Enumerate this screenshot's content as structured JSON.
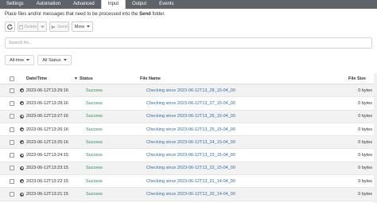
{
  "tabs": [
    {
      "label": "Settings"
    },
    {
      "label": "Automation"
    },
    {
      "label": "Advanced"
    },
    {
      "label": "Input"
    },
    {
      "label": "Output"
    },
    {
      "label": "Events"
    }
  ],
  "intro": {
    "prefix": "Place files and/or messages that need to be processed into the ",
    "folder": "Send",
    "suffix": " folder."
  },
  "toolbar": {
    "delete_label": "Delete",
    "send_label": "Send",
    "more_label": "More"
  },
  "search": {
    "placeholder": "Search for..."
  },
  "filters": {
    "time_label": "All-time",
    "status_label": "All Status"
  },
  "table": {
    "headers": {
      "date": "Date/Time",
      "status": "Status",
      "name": "File Name",
      "size": "File Size"
    },
    "rows": [
      {
        "date": "2023-06-12T13:29:16",
        "status": "Success",
        "name": "Checking since 2023-06-12T13_28_15-04_00",
        "size": "0 bytes"
      },
      {
        "date": "2023-06-12T13:28:16",
        "status": "Success",
        "name": "Checking since 2023-06-12T13_27_15-04_00",
        "size": "0 bytes"
      },
      {
        "date": "2023-06-12T13:27:16",
        "status": "Success",
        "name": "Checking since 2023-06-12T13_26_15-04_00",
        "size": "0 bytes"
      },
      {
        "date": "2023-06-12T13:26:16",
        "status": "Success",
        "name": "Checking since 2023-06-12T13_25_15-04_00",
        "size": "0 bytes"
      },
      {
        "date": "2023-06-12T13:25:16",
        "status": "Success",
        "name": "Checking since 2023-06-12T13_24_15-04_00",
        "size": "0 bytes"
      },
      {
        "date": "2023-06-12T13:24:15",
        "status": "Success",
        "name": "Checking since 2023-06-12T13_23_15-04_00",
        "size": "0 bytes"
      },
      {
        "date": "2023-06-12T13:23:15",
        "status": "Success",
        "name": "Checking since 2023-06-12T13_22_15-04_00",
        "size": "0 bytes"
      },
      {
        "date": "2023-06-12T13:22:15",
        "status": "Success",
        "name": "Checking since 2023-06-12T13_21_14-04_00",
        "size": "0 bytes"
      },
      {
        "date": "2023-06-12T13:21:15",
        "status": "Success",
        "name": "Checking since 2023-06-12T13_20_14-04_00",
        "size": "0 bytes"
      }
    ]
  },
  "colors": {
    "tabbar": "#5f6368",
    "status_success": "#2e8b57",
    "file_link": "#2a6fb0",
    "row_alt": "#f2f2f2"
  }
}
